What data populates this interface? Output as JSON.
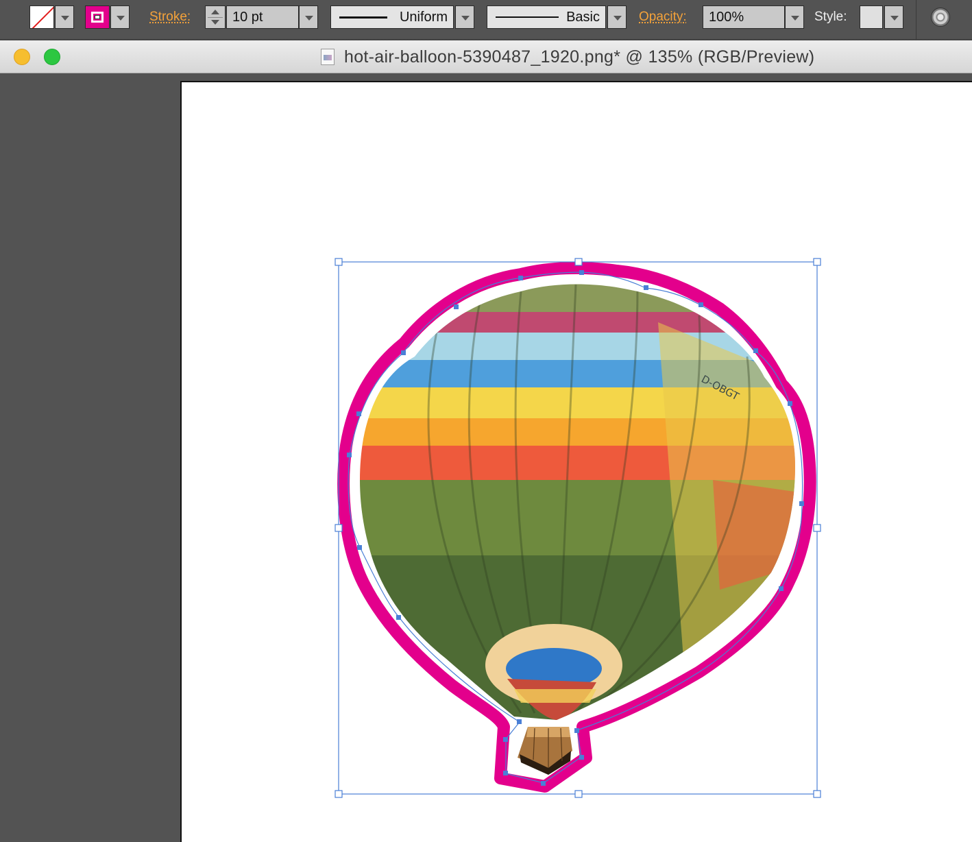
{
  "control_bar": {
    "fill_swatch": "none",
    "stroke_swatch_color": "#e3008c",
    "stroke_label": "Stroke:",
    "stroke_weight": "10 pt",
    "variable_width_profile": "Uniform",
    "brush_definition": "Basic",
    "opacity_label": "Opacity:",
    "opacity_value": "100%",
    "style_label": "Style:",
    "globe_icon": "recolor-artwork-icon"
  },
  "document": {
    "title": "hot-air-balloon-5390487_1920.png* @ 135% (RGB/Preview)",
    "zoom": "135%"
  },
  "artwork": {
    "balloon_label": "D-OBGT",
    "stroke_color": "#e3008c",
    "selection_color": "#4a7fd6"
  }
}
